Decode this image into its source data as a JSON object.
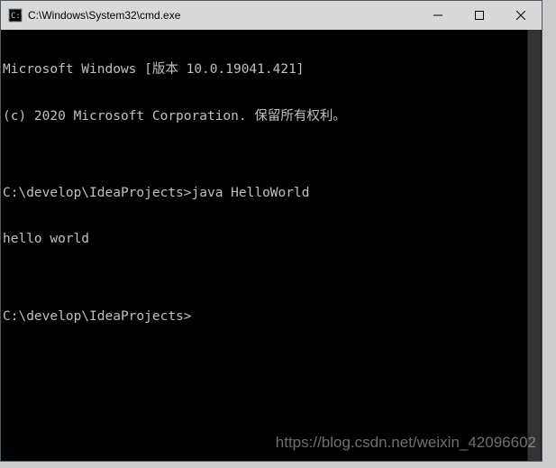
{
  "window": {
    "title": "C:\\Windows\\System32\\cmd.exe"
  },
  "terminal": {
    "lines": [
      "Microsoft Windows [版本 10.0.19041.421]",
      "(c) 2020 Microsoft Corporation. 保留所有权利。",
      "",
      "C:\\develop\\IdeaProjects>java HelloWorld",
      "hello world",
      "",
      "C:\\develop\\IdeaProjects>"
    ]
  },
  "watermark": "https://blog.csdn.net/weixin_42096602"
}
